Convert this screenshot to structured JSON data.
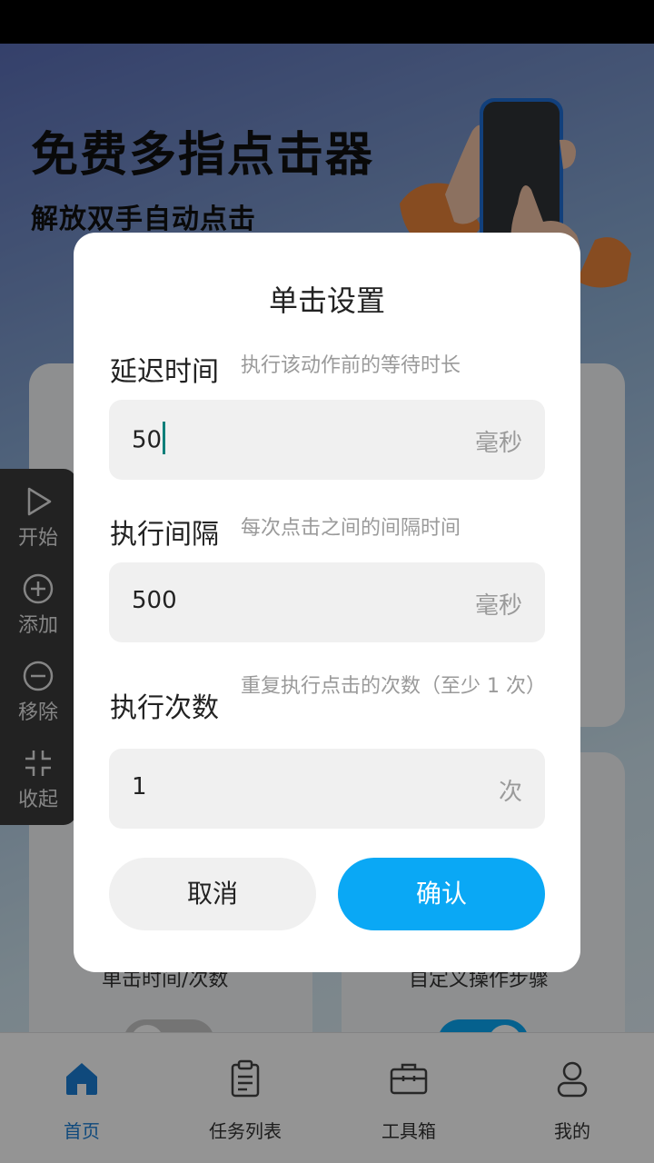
{
  "hero": {
    "title": "免费多指点击器",
    "subtitle": "解放双手自动点击"
  },
  "cards": {
    "left_caption": "单击时间/次数",
    "right_caption": "自定义操作步骤"
  },
  "float_panel": {
    "items": [
      {
        "label": "开始",
        "icon": "play-icon"
      },
      {
        "label": "添加",
        "icon": "plus-circle-icon"
      },
      {
        "label": "移除",
        "icon": "minus-circle-icon"
      },
      {
        "label": "收起",
        "icon": "collapse-icon"
      }
    ]
  },
  "dialog": {
    "title": "单击设置",
    "fields": [
      {
        "label": "延迟时间",
        "hint": "执行该动作前的等待时长",
        "value": "50",
        "unit": "毫秒"
      },
      {
        "label": "执行间隔",
        "hint": "每次点击之间的间隔时间",
        "value": "500",
        "unit": "毫秒"
      },
      {
        "label": "执行次数",
        "hint": "重复执行点击的次数（至少 1 次）",
        "value": "1",
        "unit": "次"
      }
    ],
    "cancel_label": "取消",
    "confirm_label": "确认"
  },
  "bottom_nav": {
    "items": [
      {
        "label": "首页",
        "icon": "home-icon",
        "active": true
      },
      {
        "label": "任务列表",
        "icon": "clipboard-icon",
        "active": false
      },
      {
        "label": "工具箱",
        "icon": "toolbox-icon",
        "active": false
      },
      {
        "label": "我的",
        "icon": "user-icon",
        "active": false
      }
    ]
  },
  "colors": {
    "accent": "#0aa8f5",
    "nav_active": "#1a7fd6",
    "caret": "#0d7f7a"
  }
}
